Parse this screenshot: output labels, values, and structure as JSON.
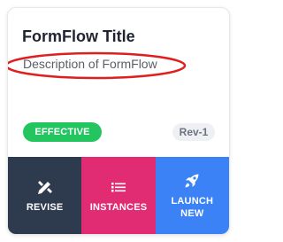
{
  "card": {
    "title": "FormFlow Title",
    "description": "Description of FormFlow",
    "status_badge": "EFFECTIVE",
    "revision": "Rev-1"
  },
  "actions": {
    "revise": "REVISE",
    "instances": "INSTANCES",
    "launch": "LAUNCH NEW"
  },
  "icons": {
    "revise": "pencil-ruler-icon",
    "instances": "list-icon",
    "launch": "rocket-icon"
  },
  "colors": {
    "badge": "#22c55e",
    "revise_bg": "#2e3a4e",
    "instances_bg": "#e12b73",
    "launch_bg": "#3b82f6",
    "highlight_ring": "#e01e1e"
  }
}
